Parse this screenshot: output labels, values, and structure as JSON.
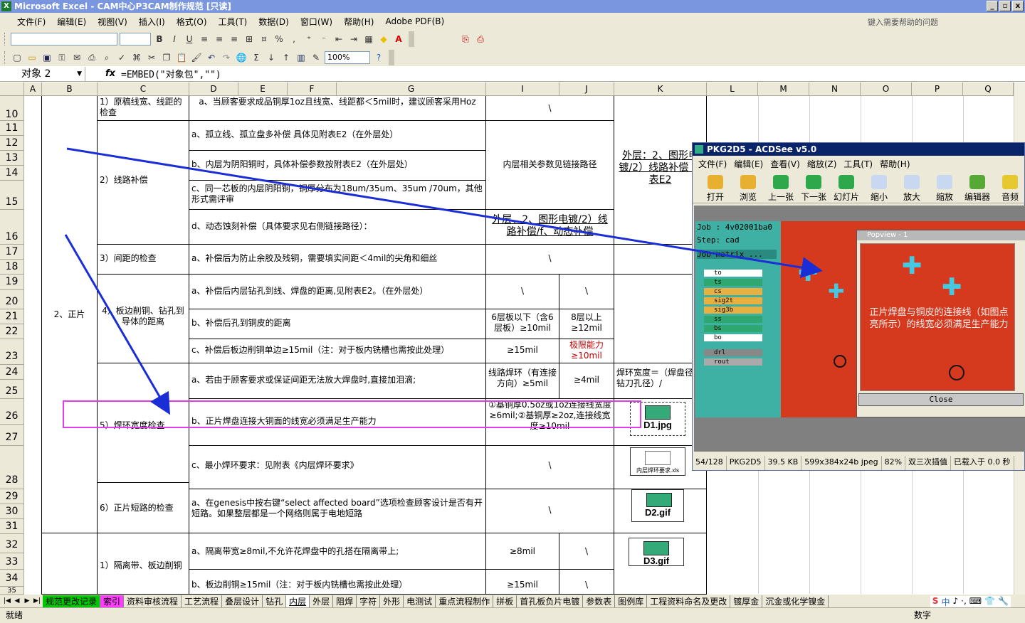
{
  "window": {
    "title": "Microsoft Excel - CAM中心P3CAM制作规范 [只读]",
    "min": "_",
    "max": "▫",
    "close": "x"
  },
  "menu": [
    "文件(F)",
    "编辑(E)",
    "视图(V)",
    "插入(I)",
    "格式(O)",
    "工具(T)",
    "数据(D)",
    "窗口(W)",
    "帮助(H)",
    "Adobe PDF(B)"
  ],
  "help_placeholder": "键入需要帮助的问题",
  "zoom": "100%",
  "namebox": "对象 2",
  "fx": "fx",
  "formula": "=EMBED(\"对象包\",\"\")",
  "columns": [
    "A",
    "B",
    "C",
    "D",
    "E",
    "F",
    "G",
    "I",
    "J",
    "K",
    "L",
    "M",
    "N",
    "O",
    "P",
    "Q"
  ],
  "rows": [
    "10",
    "11",
    "12",
    "13",
    "14",
    "15",
    "16",
    "17",
    "18",
    "19",
    "20",
    "21",
    "22",
    "23",
    "24",
    "25",
    "26",
    "27",
    "28",
    "29",
    "30",
    "31",
    "32",
    "33",
    "34",
    "35"
  ],
  "cells": {
    "b_main": "2、正片",
    "c10": "1）原稿线宽、线距的检查",
    "d10": "a、当顾客要求成品铜厚1oz且线宽、线距都＜5mil时，建议顾客采用Hoz",
    "i10": "\\",
    "c_line": "2）线路补偿",
    "d11": "a、孤立线、孤立盘多补偿 具体见附表E2（在外层处）",
    "d13": "b、内层为阴阳铜时，具体补偿参数按附表E2（在外层处）",
    "d15": "c、同一芯板的内层阴阳铜，铜厚分布为18um/35um、35um /70um，其他形式需评审",
    "d16": "d、动态蚀刻补偿（具体要求见右侧链接路径）：",
    "i_line": "内层相关参数见链接路径",
    "link16": "外层、2、图形电镀/2）线路补偿/f、动态补偿",
    "k_link": "外层：2、图形电镀/2）线路补偿 附表E2",
    "c17": "3）间距的检查",
    "d17": "a、补偿后为防止余胶及残铜，需要填实间距＜4mil的尖角和细丝",
    "i17": "\\",
    "c_edge": "4）板边削铜、钻孔到导体的距离",
    "d19": "a、补偿后内层钻孔到线、焊盘的距离,见附表E2。（在外层处）",
    "i19": "\\",
    "j19": "\\",
    "d21": "b、补偿后孔到铜皮的距离",
    "i21": "6层板以下（含6层板）≥10mil",
    "j21": "8层以上≥12mil",
    "d23": "c、补偿后板边削铜单边≥15mil（注：对于板内铣槽也需按此处理）",
    "i23": "≥15mil",
    "j23": "极限能力≥10mil",
    "d24": "a、若由于顾客要求或保证间距无法放大焊盘时,直接加泪滴;",
    "i24": "线路焊环（有连接方向）≥5mil",
    "j24": "≥4mil",
    "k24": "焊环宽度＝（焊盘径-钻刀孔径）/",
    "c26": "5）焊环宽度检查",
    "d26": "b、正片焊盘连接大铜面的线宽必须满足生产能力",
    "i26": "①基铜厚0.5oz或1oz连接线宽度≥6mil;②基铜厚≥2oz,连接线宽度≥10mil",
    "icon26": "D1.jpg",
    "d28": "c、最小焊环要求：见附表《内层焊环要求》",
    "i28": "\\",
    "icon28": "内层焊环要求.xls",
    "c29": "6）正片短路的检查",
    "d29": "a、在genesis中按右键“select affected board”选项检查顾客设计是否有开短路。如果整层都是一个网络则属于电地短路",
    "i29": "\\",
    "icon29": "D2.gif",
    "c32": "1）隔离带、板边削铜",
    "d32": "a、隔离带宽≥8mil,不允许花焊盘中的孔搭在隔离带上;",
    "i32": "≥8mil",
    "j32": "\\",
    "icon32": "D3.gif",
    "d34": "b、板边削铜≥15mil（注：对于板内铣槽也需按此处理）",
    "i34": "≥15mil",
    "j34": "\\"
  },
  "sheet_tabs": [
    "规范更改记录",
    "索引",
    "资料审核流程",
    "工艺流程",
    "叠层设计",
    "钻孔",
    "内层",
    "外层",
    "阻焊",
    "字符",
    "外形",
    "电测试",
    "重点流程制作",
    "拼板",
    "首孔板负片电镀",
    "参数表",
    "图例库",
    "工程资料命名及更改",
    "镀厚金",
    "沉金或化学镍金"
  ],
  "status": {
    "left": "就绪",
    "num": "数字"
  },
  "ime": [
    "S",
    "中",
    "♪",
    "·,",
    "⌨",
    "👕",
    "🔧"
  ],
  "acdsee": {
    "title": "PKG2D5 - ACDSee v5.0",
    "menu": [
      "文件(F)",
      "编辑(E)",
      "查看(V)",
      "缩放(Z)",
      "工具(T)",
      "帮助(H)"
    ],
    "toolbar": [
      "打开",
      "浏览",
      "上一张",
      "下一张",
      "幻灯片",
      "缩小",
      "放大",
      "缩放",
      "编辑器",
      "音频"
    ],
    "job": "Job : 4v02001ba0",
    "step": "Step: cad",
    "matrix": "Job matrix ...",
    "layers": [
      "to",
      "ts",
      "cs",
      "sig2t",
      "sig3b",
      "ss",
      "bs",
      "bo",
      "drl",
      "rout"
    ],
    "popview_title": "Popview - 1",
    "popview_text": "正片焊盘与铜皮的连接线（如图点亮所示）的线宽必须满足生产能力",
    "close": "Close",
    "status": [
      "54/128",
      "PKG2D5",
      "39.5 KB",
      "599x384x24b jpeg",
      "82%",
      "双三次插值",
      "已载入于 0.0 秒"
    ]
  }
}
